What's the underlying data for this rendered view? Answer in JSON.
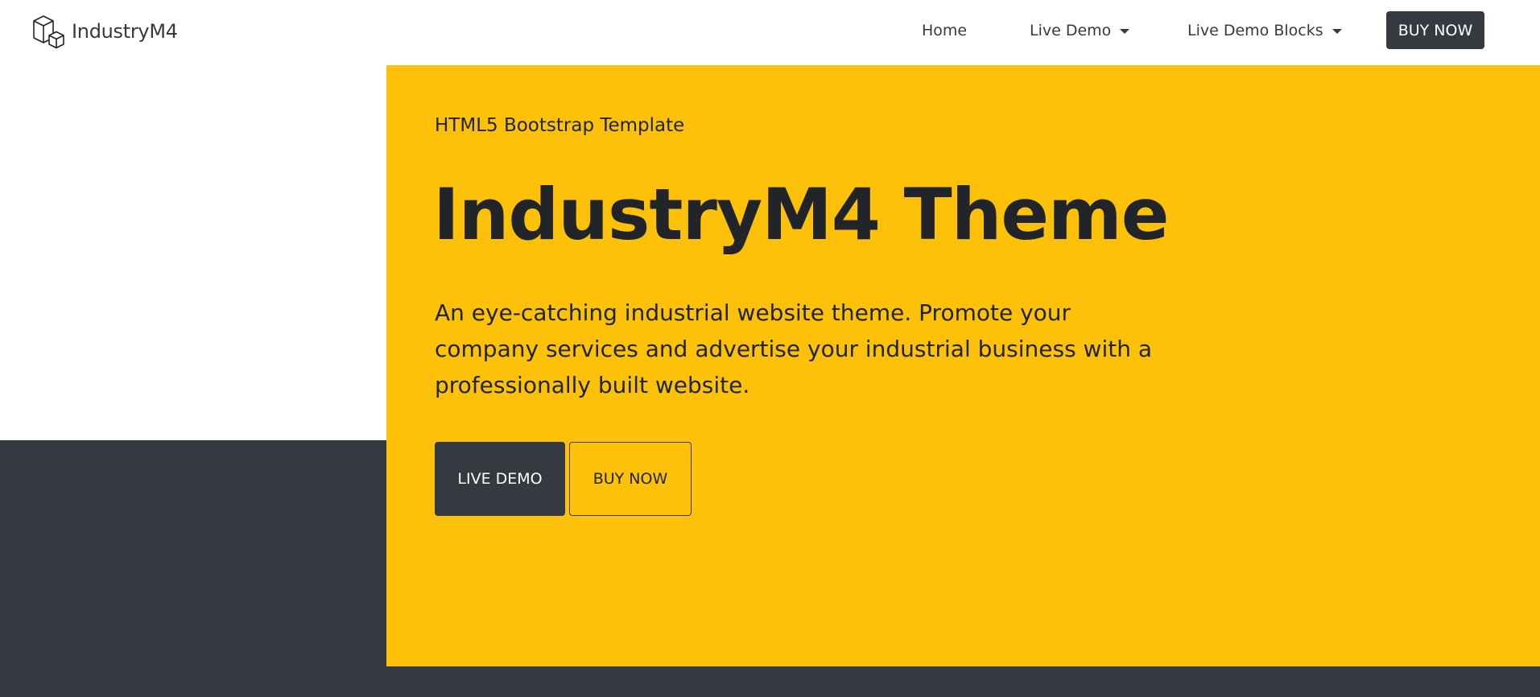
{
  "navbar": {
    "brand": {
      "logo_icon": "isometric-cubes-icon",
      "name": "IndustryM4"
    },
    "links": [
      {
        "label": "Home",
        "has_dropdown": false
      },
      {
        "label": "Live Demo",
        "has_dropdown": true
      },
      {
        "label": "Live Demo Blocks",
        "has_dropdown": true
      }
    ],
    "cta_label": "BUY NOW"
  },
  "hero": {
    "eyebrow": "HTML5 Bootstrap Template",
    "title": "IndustryM4 Theme",
    "lead": "An eye-catching industrial website theme. Promote your company services and advertise your industrial business with a professionally built website.",
    "primary_button": "LIVE DEMO",
    "secondary_button": "BUY NOW"
  },
  "colors": {
    "accent": "#fdc10a",
    "dark": "#343a40",
    "text": "#212529",
    "background": "#ffffff"
  }
}
